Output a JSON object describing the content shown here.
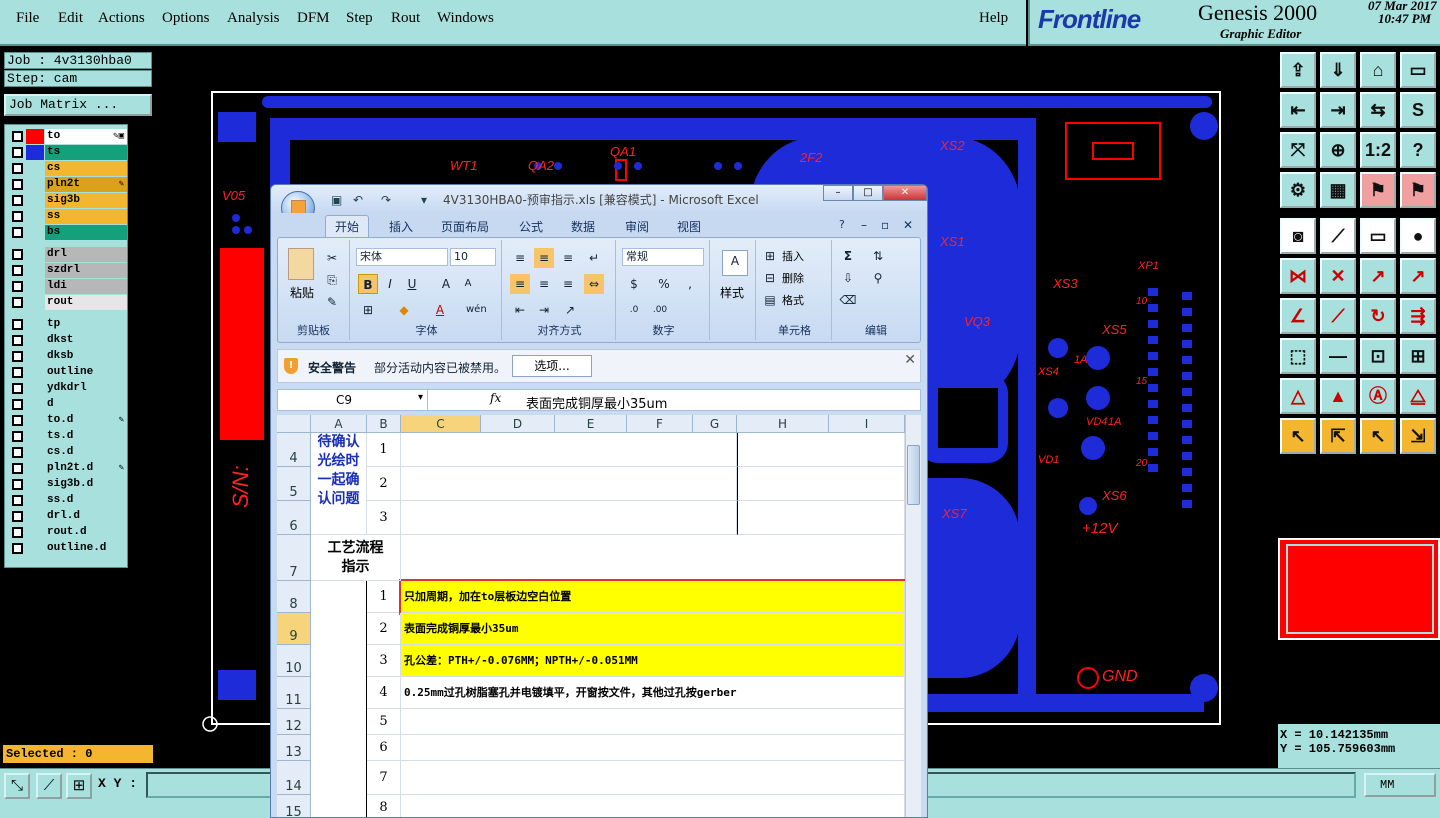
{
  "menubar": {
    "items": [
      "File",
      "Edit",
      "Actions",
      "Options",
      "Analysis",
      "DFM",
      "Step",
      "Rout",
      "Windows"
    ],
    "help": "Help"
  },
  "brand": {
    "logo": "Frontline",
    "product": "Genesis 2000",
    "subtitle": "Graphic Editor",
    "date": "07 Mar 2017",
    "time": "10:47 PM"
  },
  "left": {
    "job": "Job : 4v3130hba0",
    "step": "Step: cam",
    "job_matrix": "Job Matrix ...",
    "selected": "Selected : 0"
  },
  "layers": [
    {
      "name": "to",
      "color": "#ffffff",
      "swatch": "#ff0000",
      "tag": "✎▣"
    },
    {
      "name": "ts",
      "color": "#13a07a",
      "swatch": "#1d2bd8",
      "tag": ""
    },
    {
      "name": "cs",
      "color": "#f5b62f",
      "swatch": "",
      "tag": ""
    },
    {
      "name": "pln2t",
      "color": "#d9a21a",
      "swatch": "",
      "tag": "✎"
    },
    {
      "name": "sig3b",
      "color": "#f5b62f",
      "swatch": "",
      "tag": ""
    },
    {
      "name": "ss",
      "color": "#f5b62f",
      "swatch": "",
      "tag": ""
    },
    {
      "name": "bs",
      "color": "#13a07a",
      "swatch": "",
      "tag": ""
    },
    {
      "name": "drl",
      "color": "#b7b7b7",
      "swatch": "",
      "tag": ""
    },
    {
      "name": "szdrl",
      "color": "#b7b7b7",
      "swatch": "",
      "tag": ""
    },
    {
      "name": "ldi",
      "color": "#b7b7b7",
      "swatch": "",
      "tag": ""
    },
    {
      "name": "rout",
      "color": "#e6e6e6",
      "swatch": "",
      "tag": ""
    },
    {
      "name": "tp",
      "color": "#a7e0dd",
      "swatch": "",
      "tag": ""
    },
    {
      "name": "dkst",
      "color": "#a7e0dd",
      "swatch": "",
      "tag": ""
    },
    {
      "name": "dksb",
      "color": "#a7e0dd",
      "swatch": "",
      "tag": ""
    },
    {
      "name": "outline",
      "color": "#a7e0dd",
      "swatch": "",
      "tag": ""
    },
    {
      "name": "ydkdrl",
      "color": "#a7e0dd",
      "swatch": "",
      "tag": ""
    },
    {
      "name": "d",
      "color": "#a7e0dd",
      "swatch": "",
      "tag": ""
    },
    {
      "name": "to.d",
      "color": "#a7e0dd",
      "swatch": "",
      "tag": "✎"
    },
    {
      "name": "ts.d",
      "color": "#a7e0dd",
      "swatch": "",
      "tag": ""
    },
    {
      "name": "cs.d",
      "color": "#a7e0dd",
      "swatch": "",
      "tag": ""
    },
    {
      "name": "pln2t.d",
      "color": "#a7e0dd",
      "swatch": "",
      "tag": "✎"
    },
    {
      "name": "sig3b.d",
      "color": "#a7e0dd",
      "swatch": "",
      "tag": ""
    },
    {
      "name": "ss.d",
      "color": "#a7e0dd",
      "swatch": "",
      "tag": ""
    },
    {
      "name": "drl.d",
      "color": "#a7e0dd",
      "swatch": "",
      "tag": ""
    },
    {
      "name": "rout.d",
      "color": "#a7e0dd",
      "swatch": "",
      "tag": ""
    },
    {
      "name": "outline.d",
      "color": "#a7e0dd",
      "swatch": "",
      "tag": ""
    }
  ],
  "bottom": {
    "xy_label": "X Y :",
    "units": "MM"
  },
  "coords": {
    "x": "X = 10.142135mm",
    "y": "Y = 105.759603mm"
  },
  "pcb_labels": [
    "V05",
    "S/N:",
    "WT1",
    "QA2",
    "QA1",
    "2F2",
    "XS2",
    "XS1",
    "VQ3",
    "XS3",
    "XP1",
    "XS5",
    "XS4",
    "1A",
    "VD4",
    "1A",
    "VD1",
    "XS6",
    "+12V",
    "XS7",
    "GND",
    "10",
    "15",
    "20"
  ],
  "excel": {
    "title": "4V3130HBA0-预审指示.xls [兼容模式] - Microsoft Excel",
    "tabs": [
      "开始",
      "插入",
      "页面布局",
      "公式",
      "数据",
      "审阅",
      "视图"
    ],
    "ribbon": {
      "clipboard": "剪贴板",
      "paste": "粘贴",
      "font_group": "字体",
      "font_name": "宋体",
      "font_size": "10",
      "align_group": "对齐方式",
      "number_group": "数字",
      "number_format": "常规",
      "styles": "样式",
      "cells_group": "单元格",
      "insert": "插入",
      "delete": "删除",
      "format": "格式",
      "edit_group": "编辑"
    },
    "security": {
      "title": "安全警告",
      "message": "部分活动内容已被禁用。",
      "button": "选项..."
    },
    "namebox": "C9",
    "fx": "fx",
    "formula": "表面完成铜厚最小35um",
    "columns": [
      "A",
      "B",
      "C",
      "D",
      "E",
      "F",
      "G",
      "H",
      "I"
    ],
    "rows": [
      {
        "num": "4",
        "b": "1",
        "c": ""
      },
      {
        "num": "5",
        "b": "2",
        "c": ""
      },
      {
        "num": "6",
        "b": "3",
        "c": ""
      },
      {
        "num": "7",
        "b": "",
        "c": ""
      },
      {
        "num": "8",
        "b": "1",
        "c": "只加周期，加在to层板边空白位置"
      },
      {
        "num": "9",
        "b": "2",
        "c": "表面完成铜厚最小35um"
      },
      {
        "num": "10",
        "b": "3",
        "c": "孔公差：PTH+/-0.076MM；NPTH+/-0.051MM"
      },
      {
        "num": "11",
        "b": "4",
        "c": "0.25mm过孔树脂塞孔并电镀填平，开窗按文件，其他过孔按gerber"
      },
      {
        "num": "12",
        "b": "5",
        "c": ""
      },
      {
        "num": "13",
        "b": "6",
        "c": ""
      },
      {
        "num": "14",
        "b": "7",
        "c": ""
      },
      {
        "num": "15",
        "b": "8",
        "c": ""
      }
    ],
    "a_merged_1": "待确认光绘时一起确认问题",
    "a_merged_2": "工艺流程指示"
  }
}
